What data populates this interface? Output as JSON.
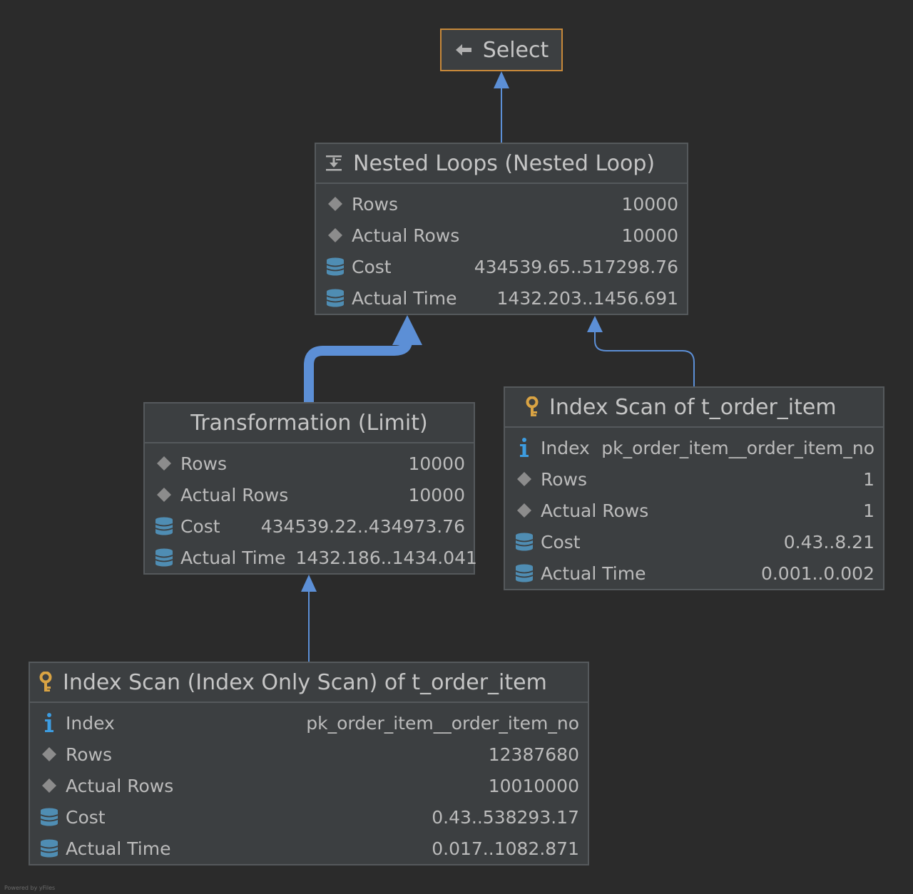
{
  "nodes": {
    "select": {
      "title": "Select",
      "icon": "return-arrow-icon"
    },
    "nested_loops": {
      "title": "Nested Loops (Nested Loop)",
      "icon": "nested-loop-icon",
      "rows": [
        {
          "label": "Rows",
          "value": "10000",
          "icon": "diamond-icon"
        },
        {
          "label": "Actual Rows",
          "value": "10000",
          "icon": "diamond-icon"
        },
        {
          "label": "Cost",
          "value": "434539.65..517298.76",
          "icon": "database-icon"
        },
        {
          "label": "Actual Time",
          "value": "1432.203..1456.691",
          "icon": "database-icon"
        }
      ]
    },
    "transformation": {
      "title": "Transformation (Limit)",
      "rows": [
        {
          "label": "Rows",
          "value": "10000",
          "icon": "diamond-icon"
        },
        {
          "label": "Actual Rows",
          "value": "10000",
          "icon": "diamond-icon"
        },
        {
          "label": "Cost",
          "value": "434539.22..434973.76",
          "icon": "database-icon"
        },
        {
          "label": "Actual Time",
          "value": "1432.186..1434.041",
          "icon": "database-icon"
        }
      ]
    },
    "index_scan_right": {
      "title": "Index Scan of t_order_item",
      "icon": "key-icon",
      "rows": [
        {
          "label": "Index",
          "value": "pk_order_item__order_item_no",
          "icon": "info-icon"
        },
        {
          "label": "Rows",
          "value": "1",
          "icon": "diamond-icon"
        },
        {
          "label": "Actual Rows",
          "value": "1",
          "icon": "diamond-icon"
        },
        {
          "label": "Cost",
          "value": "0.43..8.21",
          "icon": "database-icon"
        },
        {
          "label": "Actual Time",
          "value": "0.001..0.002",
          "icon": "database-icon"
        }
      ]
    },
    "index_only_scan": {
      "title": "Index Scan (Index Only Scan) of t_order_item",
      "icon": "key-icon",
      "rows": [
        {
          "label": "Index",
          "value": "pk_order_item__order_item_no",
          "icon": "info-icon"
        },
        {
          "label": "Rows",
          "value": "12387680",
          "icon": "diamond-icon"
        },
        {
          "label": "Actual Rows",
          "value": "10010000",
          "icon": "diamond-icon"
        },
        {
          "label": "Cost",
          "value": "0.43..538293.17",
          "icon": "database-icon"
        },
        {
          "label": "Actual Time",
          "value": "0.017..1082.871",
          "icon": "database-icon"
        }
      ]
    }
  },
  "colors": {
    "background": "#2b2b2b",
    "node_fill": "#3c3f41",
    "node_border": "#55595c",
    "root_border": "#c7893a",
    "edge": "#5c8fd6",
    "key": "#d9a343",
    "info": "#3d9ce0",
    "database": "#4f8db3",
    "diamond": "#8c8c8c"
  },
  "watermark": "Powered by yFiles"
}
